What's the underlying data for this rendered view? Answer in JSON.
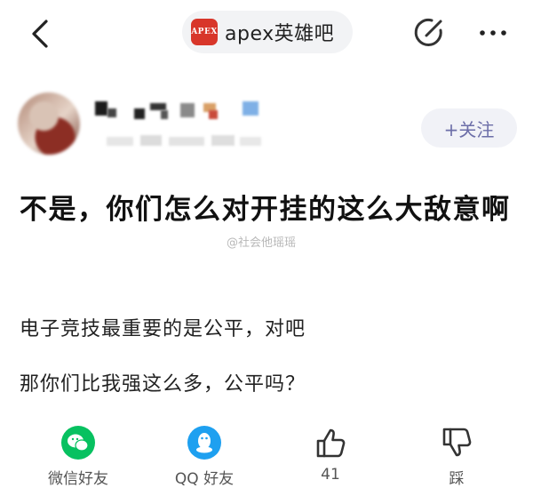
{
  "header": {
    "forum_logo_text": "APEX",
    "forum_name": "apex英雄吧"
  },
  "author": {
    "follow_label": "+关注"
  },
  "post": {
    "title": "不是，你们怎么对开挂的这么大敌意啊",
    "paragraphs": [
      "电子竞技最重要的是公平，对吧",
      "那你们比我强这么多，公平吗？"
    ],
    "watermark": "@社会他瑶瑶"
  },
  "actions": {
    "wechat_label": "微信好友",
    "qq_label": "QQ 好友",
    "like_count": "41",
    "dislike_label": "踩"
  },
  "colors": {
    "wechat": "#07c160",
    "qq": "#1ea0f0",
    "follow_text": "#6c6ea8",
    "forum_logo_bg": "#d8362a"
  }
}
